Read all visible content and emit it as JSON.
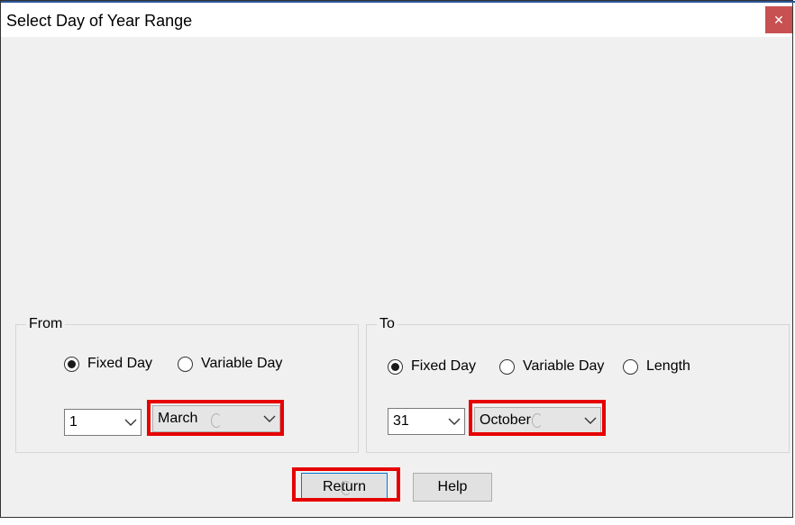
{
  "window": {
    "title": "Select Day of Year Range",
    "close_symbol": "✕"
  },
  "from": {
    "legend": "From",
    "radio_fixed": "Fixed Day",
    "radio_variable": "Variable Day",
    "selected_radio": "Fixed Day",
    "day_value": "1",
    "month_value": "March"
  },
  "to": {
    "legend": "To",
    "radio_fixed": "Fixed Day",
    "radio_variable": "Variable Day",
    "radio_length": "Length",
    "selected_radio": "Fixed Day",
    "day_value": "31",
    "month_value": "October"
  },
  "buttons": {
    "return_label": "Return",
    "help_label": "Help"
  },
  "icons": {
    "dropdown": "chevron-down-icon",
    "close": "close-icon",
    "cursor": "busy-cursor-icon"
  },
  "colors": {
    "highlight": "#e60000",
    "close_button": "#c75050",
    "dialog_background": "#f0f0f0"
  }
}
